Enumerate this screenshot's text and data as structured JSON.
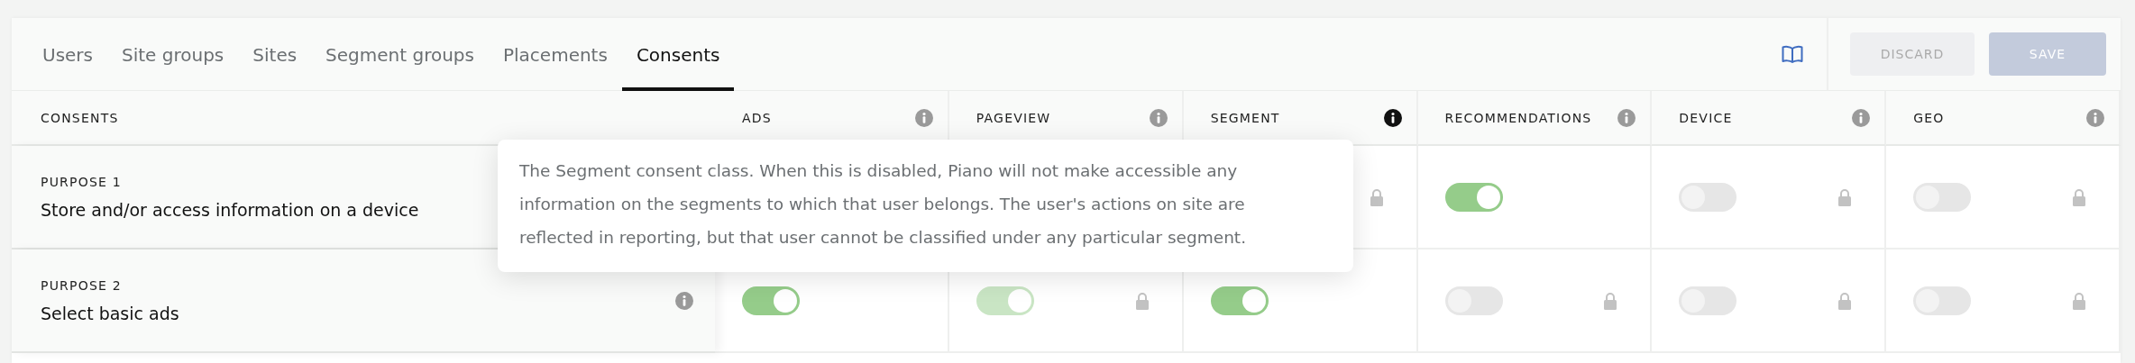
{
  "tabs": [
    {
      "label": "Users",
      "selected": false
    },
    {
      "label": "Site groups",
      "selected": false
    },
    {
      "label": "Sites",
      "selected": false
    },
    {
      "label": "Segment groups",
      "selected": false
    },
    {
      "label": "Placements",
      "selected": false
    },
    {
      "label": "Consents",
      "selected": true
    }
  ],
  "actions": {
    "discard": {
      "label": "DISCARD",
      "disabled": true
    },
    "save": {
      "label": "SAVE",
      "disabled": true
    }
  },
  "table": {
    "first_column": "CONSENTS",
    "columns": [
      {
        "label": "ADS",
        "info_active": false
      },
      {
        "label": "PAGEVIEW",
        "info_active": false
      },
      {
        "label": "SEGMENT",
        "info_active": true
      },
      {
        "label": "RECOMMENDATIONS",
        "info_active": false
      },
      {
        "label": "DEVICE",
        "info_active": false
      },
      {
        "label": "GEO",
        "info_active": false
      }
    ],
    "rows": [
      {
        "category": "PURPOSE 1",
        "title": "Store and/or access information on a device",
        "cells": [
          {
            "kind": "covered"
          },
          {
            "kind": "covered"
          },
          {
            "kind": "covered",
            "locked": true
          },
          {
            "kind": "toggle",
            "on": true,
            "disabled": false,
            "locked": false
          },
          {
            "kind": "toggle",
            "on": false,
            "disabled": false,
            "locked": true
          },
          {
            "kind": "toggle",
            "on": false,
            "disabled": false,
            "locked": true
          }
        ]
      },
      {
        "category": "PURPOSE 2",
        "title": "Select basic ads",
        "info": true,
        "cells": [
          {
            "kind": "toggle",
            "on": true,
            "disabled": false,
            "locked": false
          },
          {
            "kind": "toggle",
            "on": true,
            "disabled": true,
            "locked": true
          },
          {
            "kind": "toggle",
            "on": true,
            "disabled": false,
            "locked": false
          },
          {
            "kind": "toggle",
            "on": false,
            "disabled": false,
            "locked": true
          },
          {
            "kind": "toggle",
            "on": false,
            "disabled": false,
            "locked": true
          },
          {
            "kind": "toggle",
            "on": false,
            "disabled": false,
            "locked": true
          }
        ]
      }
    ]
  },
  "tooltip": {
    "text": "The Segment consent class. When this is disabled, Piano will not make accessible any information on the segments to which that user belongs. The user's actions on site are reflected in reporting, but that user cannot be classified under any particular segment."
  }
}
